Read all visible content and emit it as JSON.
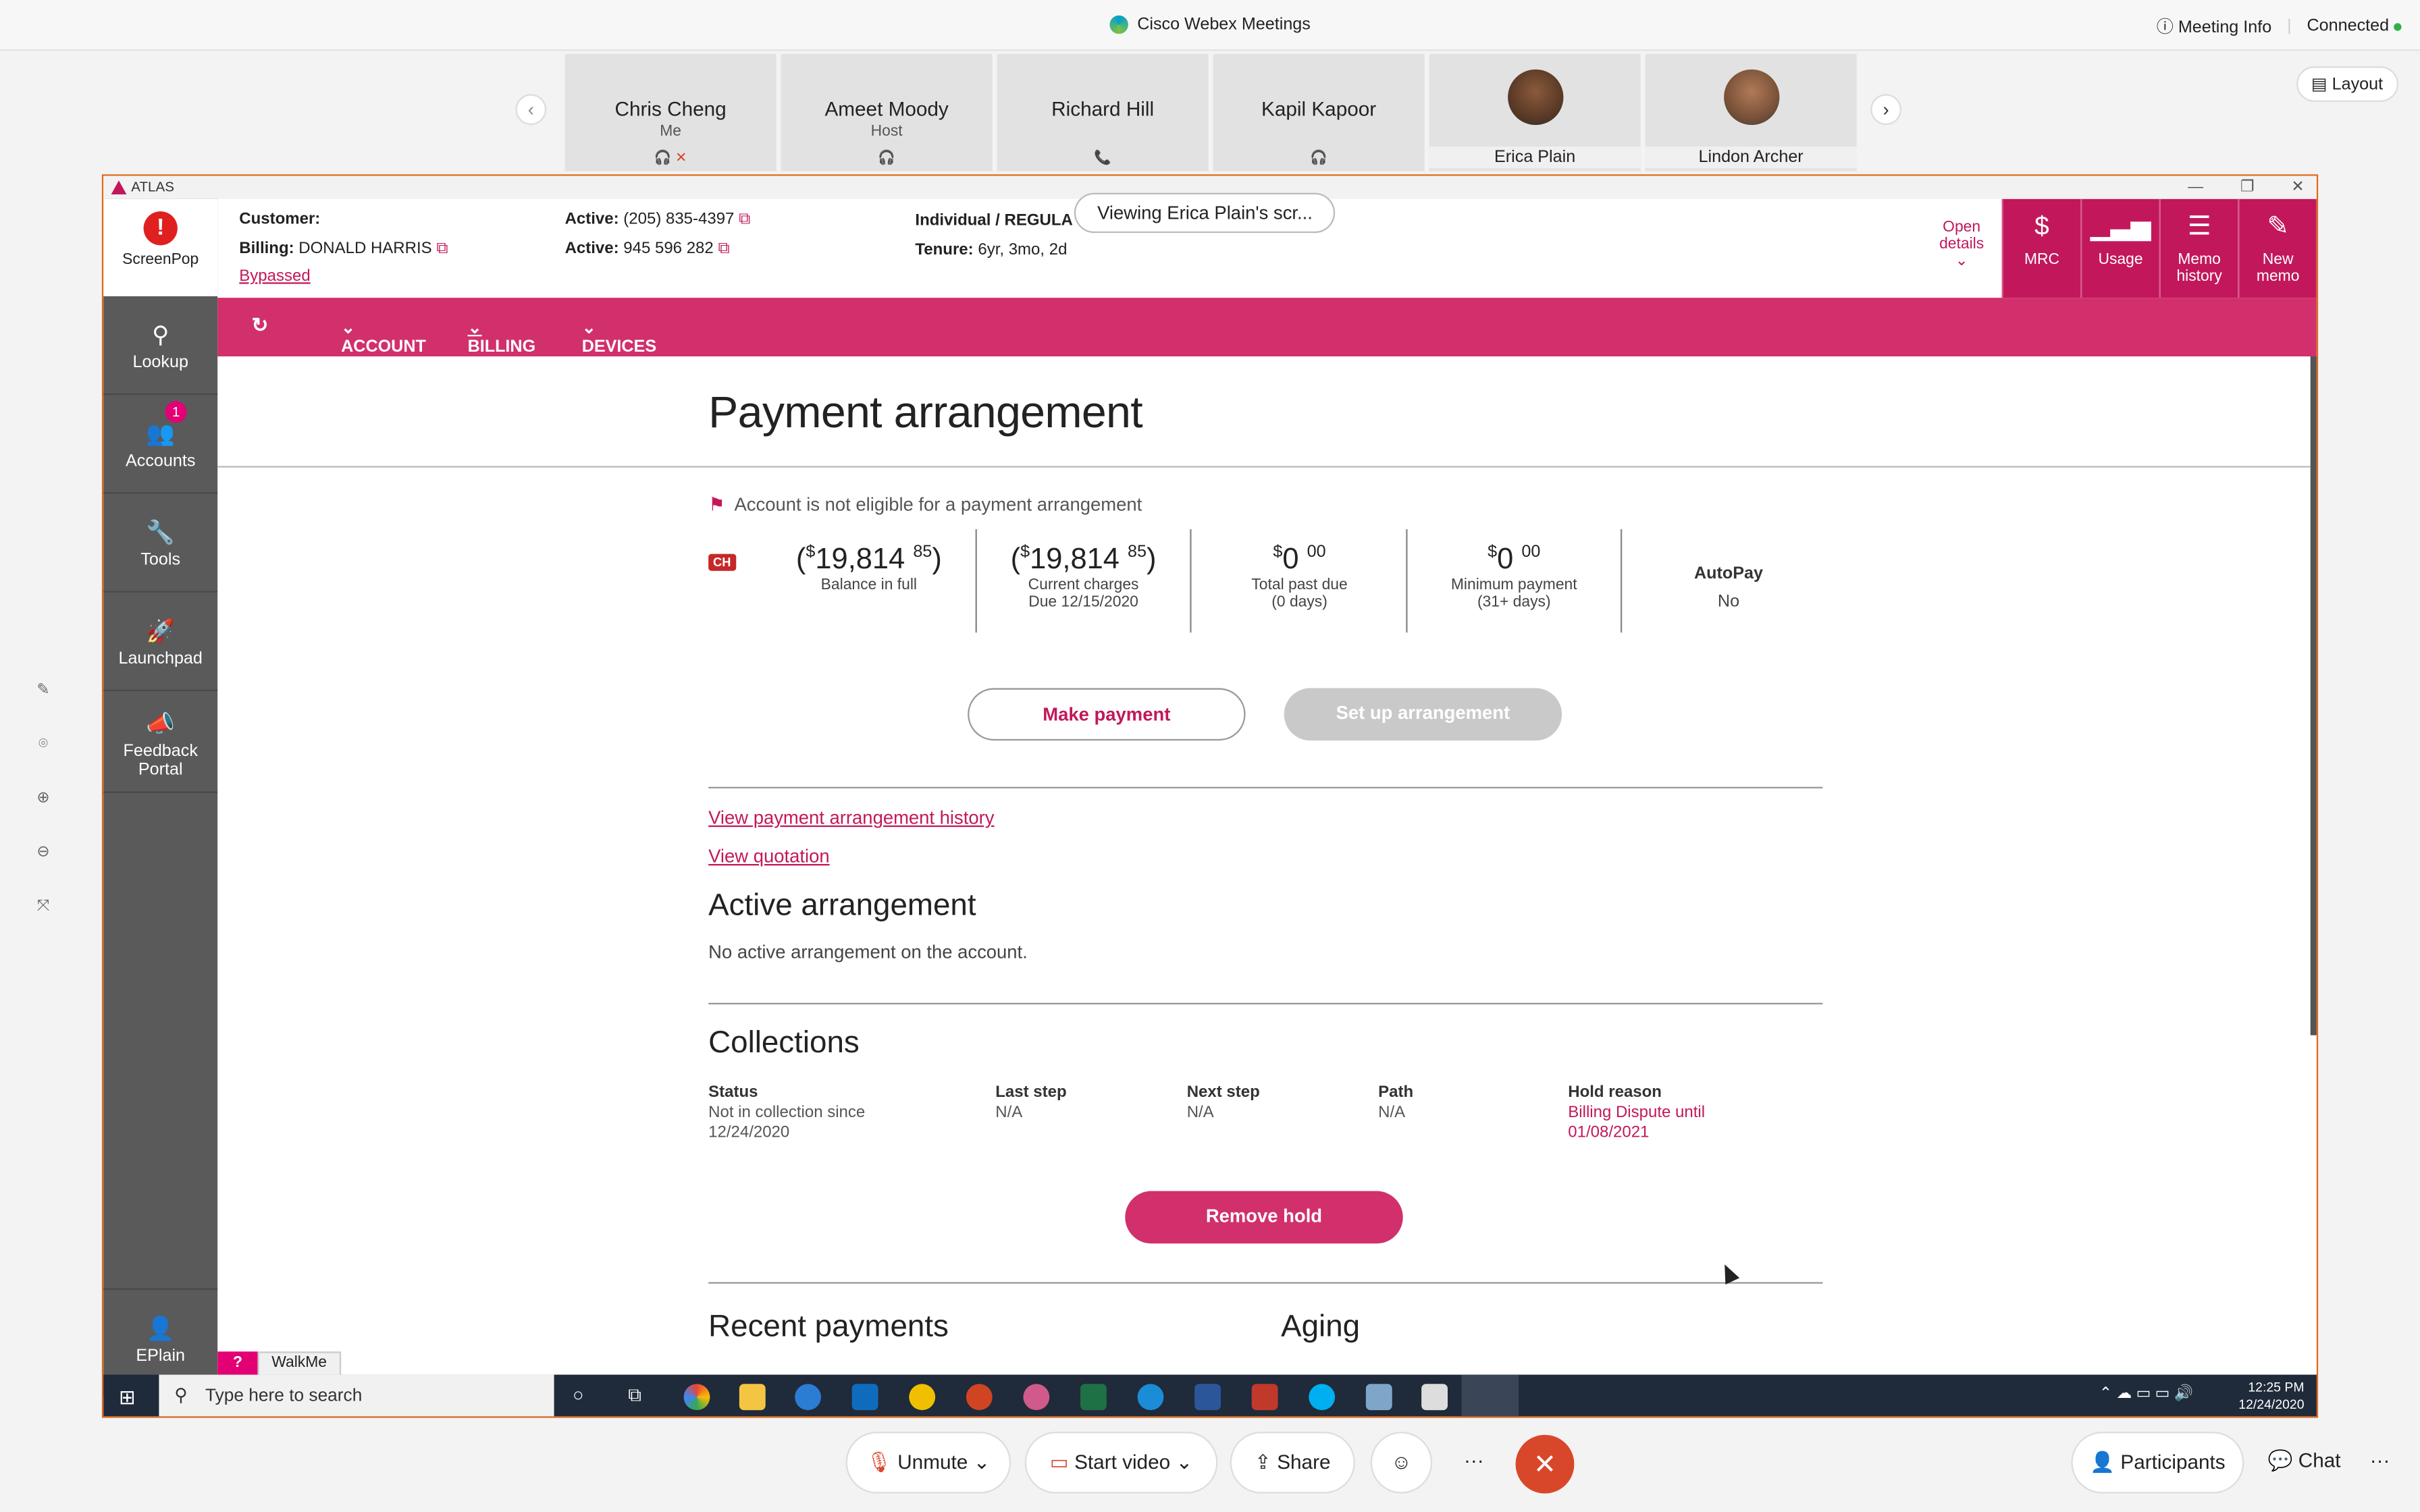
{
  "webex": {
    "title": "Cisco Webex Meetings",
    "meeting_info": "Meeting Info",
    "status": "Connected",
    "layout_btn": "Layout",
    "participants": [
      {
        "name": "Chris Cheng",
        "role": "Me"
      },
      {
        "name": "Ameet Moody",
        "role": "Host"
      },
      {
        "name": "Richard Hill",
        "role": ""
      },
      {
        "name": "Kapil Kapoor",
        "role": ""
      },
      {
        "name": "Erica Plain",
        "role": ""
      },
      {
        "name": "Lindon Archer",
        "role": ""
      }
    ],
    "sharing_tooltip": "Viewing Erica Plain's scr...",
    "controls": {
      "unmute": "Unmute",
      "start_video": "Start video",
      "share": "Share",
      "more": "···",
      "participants": "Participants",
      "chat": "Chat"
    }
  },
  "atlas": {
    "window_title": "ATLAS",
    "sidebar": {
      "screenpop": "ScreenPop",
      "items": [
        {
          "label": "Lookup",
          "icon": "search-icon"
        },
        {
          "label": "Accounts",
          "icon": "users-icon",
          "badge": "1"
        },
        {
          "label": "Tools",
          "icon": "wrench-icon"
        },
        {
          "label": "Launchpad",
          "icon": "rocket-icon"
        },
        {
          "label": "Feedback Portal",
          "icon": "megaphone-icon"
        }
      ],
      "user": "EPlain"
    },
    "info": {
      "customer_label": "Customer:",
      "billing_label": "Billing:",
      "billing_name": "DONALD HARRIS",
      "bypassed": "Bypassed",
      "active_label": "Active:",
      "active1": "(205) 835-4397",
      "active2": "945 596 282",
      "account_type": "Individual",
      "plan": "REGULA",
      "tenure_label": "Tenure:",
      "tenure": "6yr, 3mo, 2d",
      "open_details": "Open details"
    },
    "top_buttons": [
      {
        "label": "MRC",
        "icon": "dollar-icon"
      },
      {
        "label": "Usage",
        "icon": "signal-icon"
      },
      {
        "label": "Memo history",
        "icon": "list-icon"
      },
      {
        "label": "New memo",
        "icon": "edit-icon"
      }
    ],
    "nav": [
      "ACCOUNT",
      "BILLING",
      "DEVICES"
    ],
    "page_title": "Payment arrangement",
    "notice": "Account is not eligible for a payment arrangement",
    "ch_badge": "CH",
    "amounts": [
      {
        "value": "19,814",
        "cents": "85",
        "paren": true,
        "label": "Balance in full",
        "sub": ""
      },
      {
        "value": "19,814",
        "cents": "85",
        "paren": true,
        "label": "Current charges",
        "sub": "Due 12/15/2020"
      },
      {
        "value": "0",
        "cents": "00",
        "paren": false,
        "label": "Total past due",
        "sub": "(0 days)"
      },
      {
        "value": "0",
        "cents": "00",
        "paren": false,
        "label": "Minimum payment",
        "sub": "(31+ days)"
      }
    ],
    "autopay_label": "AutoPay",
    "autopay_value": "No",
    "make_payment": "Make payment",
    "setup_arrangement": "Set up arrangement",
    "link_history": "View payment arrangement history",
    "link_quotation": "View quotation",
    "active_arrangement_title": "Active arrangement",
    "active_arrangement_text": "No active arrangement on the account.",
    "collections_title": "Collections",
    "collections": [
      {
        "header": "Status",
        "value1": "Not in collection since",
        "value2": "12/24/2020"
      },
      {
        "header": "Last step",
        "value1": "N/A",
        "value2": ""
      },
      {
        "header": "Next step",
        "value1": "N/A",
        "value2": ""
      },
      {
        "header": "Path",
        "value1": "N/A",
        "value2": ""
      },
      {
        "header": "Hold reason",
        "value1": "Billing Dispute until",
        "value2": "01/08/2021"
      }
    ],
    "remove_hold": "Remove hold",
    "recent_payments_title": "Recent payments",
    "aging_title": "Aging",
    "walkme_q": "?",
    "walkme": "WalkMe"
  },
  "taskbar": {
    "search_placeholder": "Type here to search",
    "time": "12:25 PM",
    "date": "12/24/2020"
  },
  "colors": {
    "accent": "#d1306c",
    "magenta": "#c2185b",
    "end_call": "#d9472b"
  }
}
